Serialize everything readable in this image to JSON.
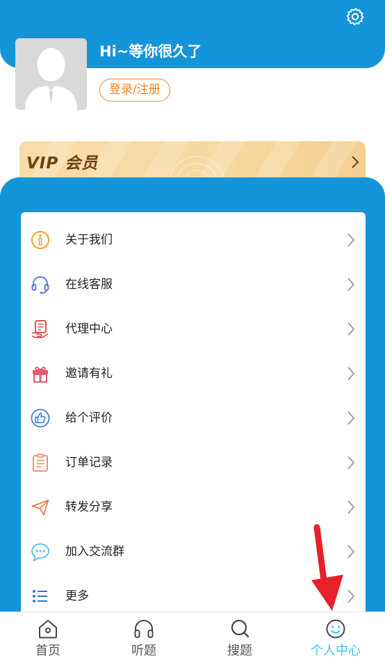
{
  "header": {
    "greeting": "Hi~等你很久了",
    "login_label": "登录/注册",
    "settings_icon": "gear-icon",
    "avatar_icon": "user-silhouette-icon"
  },
  "vip": {
    "label": "VIP 会员"
  },
  "menu": {
    "items": [
      {
        "label": "关于我们",
        "icon": "info-icon",
        "color": "#f0a020"
      },
      {
        "label": "在线客服",
        "icon": "headset-icon",
        "color": "#5a7fe0"
      },
      {
        "label": "代理中心",
        "icon": "agent-icon",
        "color": "#e0524e"
      },
      {
        "label": "邀请有礼",
        "icon": "gift-icon",
        "color": "#e35b6f"
      },
      {
        "label": "给个评价",
        "icon": "thumbs-up-icon",
        "color": "#3f7fd8"
      },
      {
        "label": "订单记录",
        "icon": "order-list-icon",
        "color": "#f0865a"
      },
      {
        "label": "转发分享",
        "icon": "paper-plane-icon",
        "color": "#ef7a4a"
      },
      {
        "label": "加入交流群",
        "icon": "chat-bubble-icon",
        "color": "#41b4e8"
      },
      {
        "label": "更多",
        "icon": "list-icon",
        "color": "#2b78d6"
      }
    ]
  },
  "tabs": [
    {
      "label": "首页",
      "icon": "home-icon"
    },
    {
      "label": "听题",
      "icon": "headphones-icon"
    },
    {
      "label": "搜题",
      "icon": "search-icon"
    },
    {
      "label": "个人中心",
      "icon": "smile-icon",
      "active": true
    }
  ],
  "colors": {
    "primary": "#1494d9",
    "accent_orange": "#f0861c",
    "active_tab": "#3cc4e8",
    "annotation_arrow": "#e8202a"
  }
}
